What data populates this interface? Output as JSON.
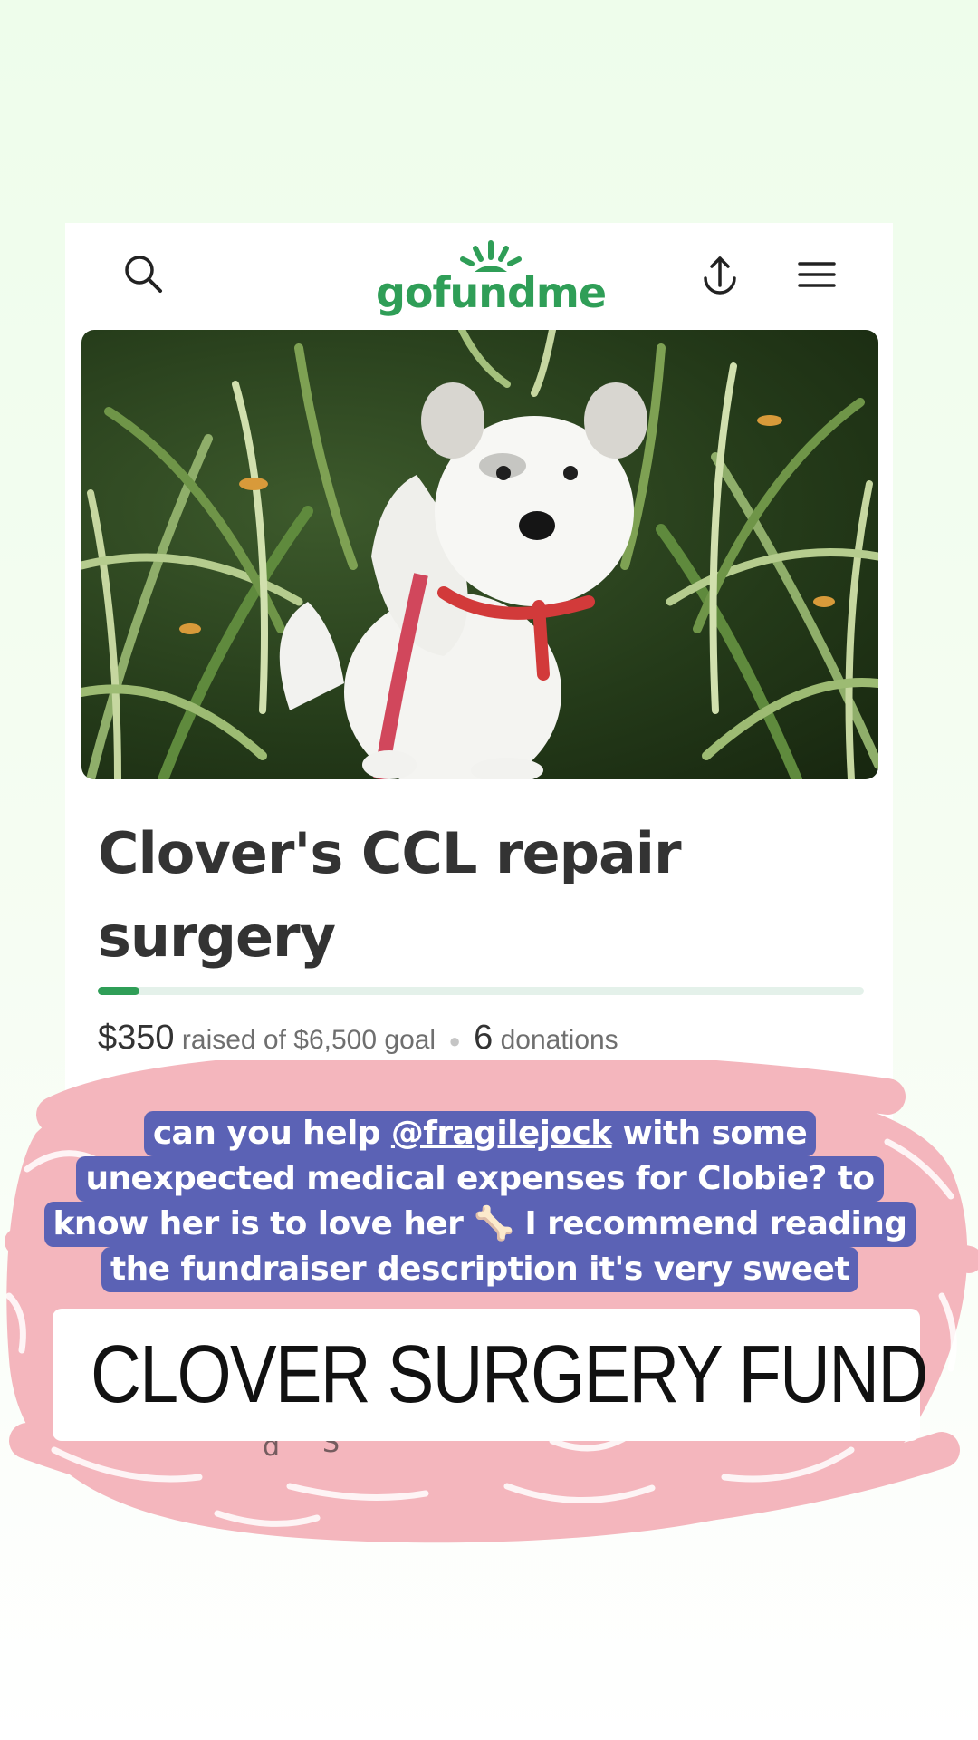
{
  "header": {
    "logo_text": "gofundme",
    "search_icon": "search-icon",
    "share_icon": "share-upload-icon",
    "menu_icon": "hamburger-menu-icon"
  },
  "hero_image": {
    "description_icon": "dog-photo"
  },
  "campaign": {
    "title": "Clover's CCL repair surgery",
    "progress_fraction": 0.054,
    "raised": "$350",
    "raised_suffix": "raised of $6,500 goal",
    "donation_count": "6",
    "donation_label": "donations"
  },
  "caption": {
    "line1_a": "can you help ",
    "line1_mention": "@fragilejock",
    "line1_b": " with some",
    "line2": "unexpected medical expenses for Clobie? to",
    "line3_a": "know her is to love her ",
    "line3_emoji": "🦴",
    "line3_b": " I recommend reading",
    "line4": "the fundraiser description it's very sweet"
  },
  "link_sticker": {
    "icon": "link-icon",
    "label": "CLOVER SURGERY FUND"
  },
  "colors": {
    "brand_green": "#2f9e57",
    "caption_bg": "#5b62b5",
    "scribble_pink": "#f4b6bd",
    "background": "#eefdeb"
  }
}
